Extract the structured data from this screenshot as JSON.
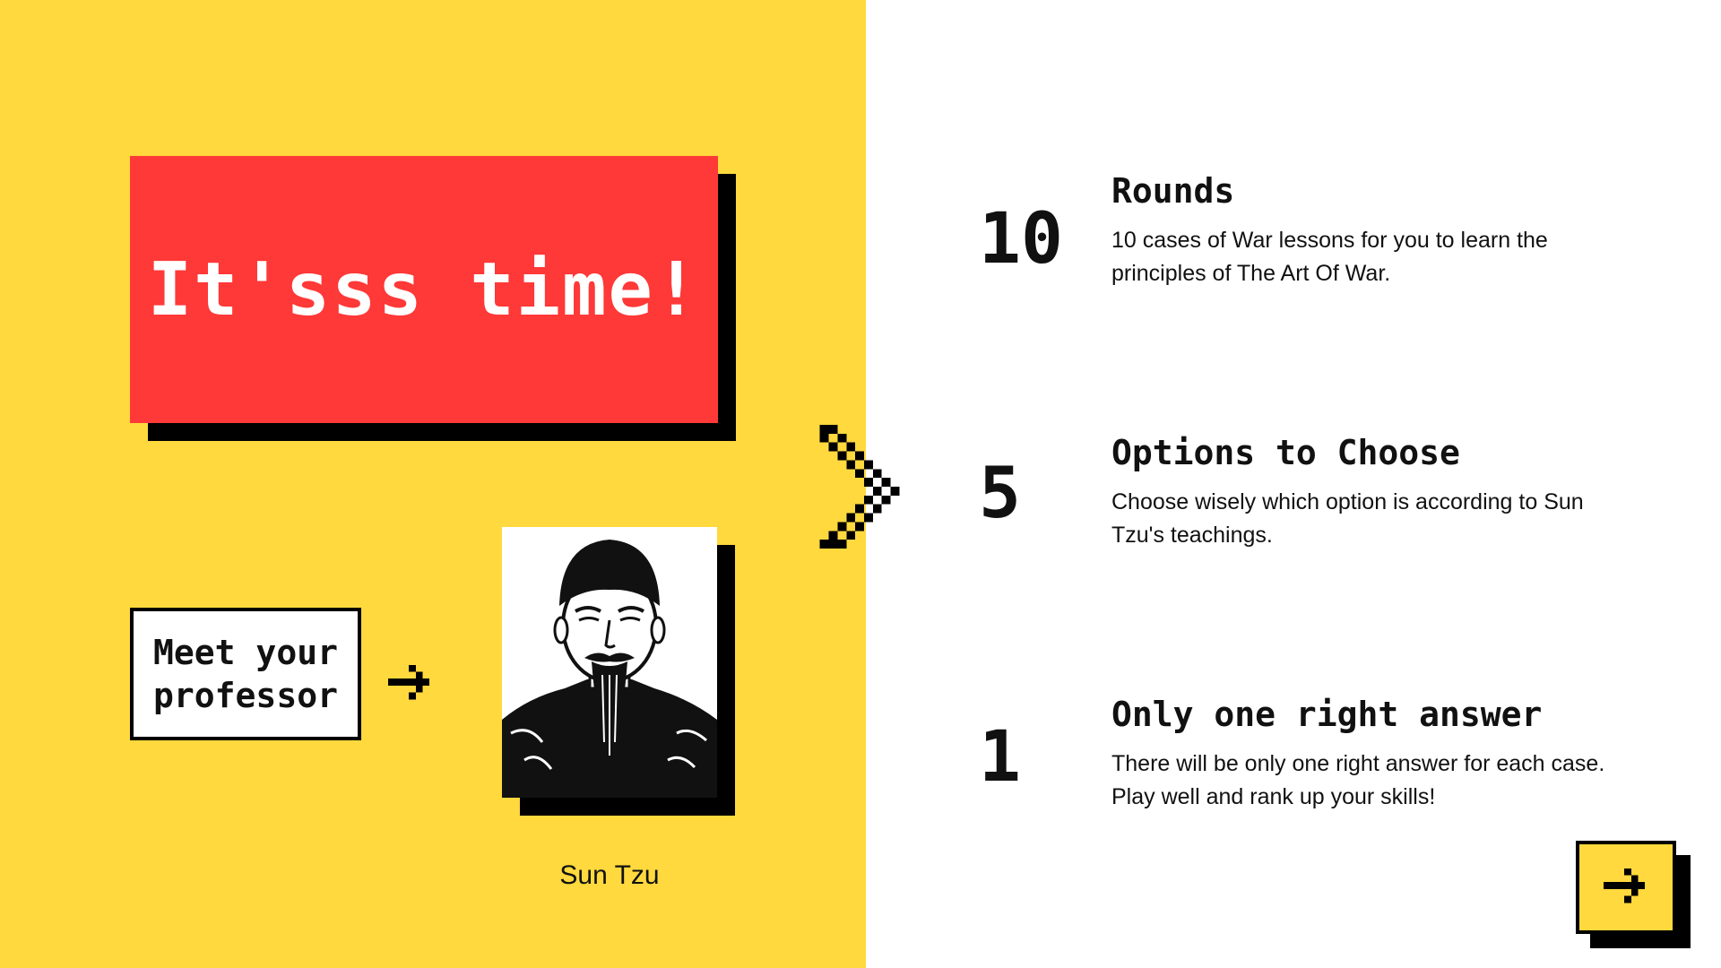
{
  "title": {
    "text": "It'sss time!"
  },
  "professor": {
    "intro_line1": "Meet your",
    "intro_line2": "professor",
    "name": "Sun Tzu",
    "portrait_icon": "sun-tzu-portrait"
  },
  "features": [
    {
      "number": "10",
      "title": "Rounds",
      "description": "10 cases of War lessons for you to learn the principles of The Art Of War."
    },
    {
      "number": "5",
      "title": "Options to Choose",
      "description": "Choose wisely which option is according to Sun Tzu's teachings."
    },
    {
      "number": "1",
      "title": "Only one right answer",
      "description": "There will be only one right answer for each case. Play well and rank up your skills!"
    }
  ],
  "icons": {
    "chevron": "chevron-right-icon",
    "small_arrow": "arrow-right-icon",
    "next": "arrow-right-icon"
  },
  "colors": {
    "yellow": "#FFD93D",
    "red": "#FF3838",
    "black": "#000000",
    "white": "#FFFFFF"
  }
}
